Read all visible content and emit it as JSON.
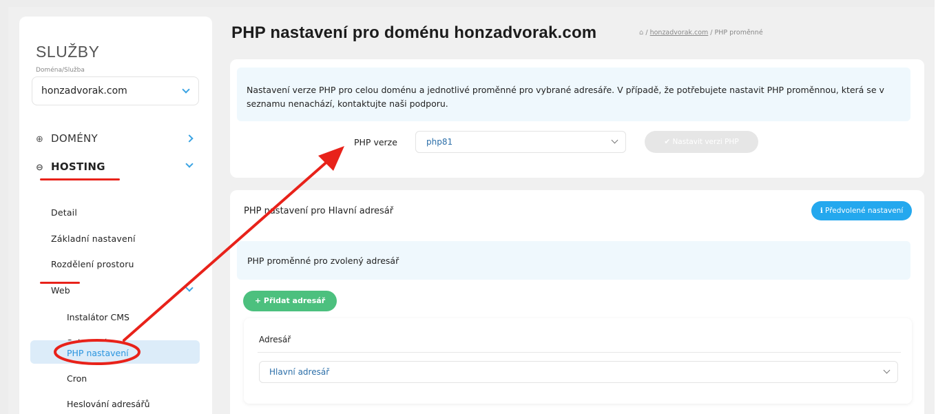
{
  "sidebar": {
    "title": "SLUŽBY",
    "domain_label": "Doména/Služba",
    "domain_value": "honzadvorak.com",
    "nav": {
      "domeny": "DOMÉNY",
      "hosting": "HOSTING"
    },
    "hosting_items": [
      "Detail",
      "Základní nastavení",
      "Rozdělení prostoru",
      "Web"
    ],
    "web_items": [
      "Instalátor CMS",
      "Subdomény",
      "PHP nastavení",
      "Cron",
      "Heslování adresářů"
    ]
  },
  "header": {
    "title": "PHP nastavení pro doménu honzadvorak.com",
    "breadcrumb": {
      "separator": "/",
      "domain": "honzadvorak.com",
      "current": "PHP proměnné"
    }
  },
  "version_card": {
    "info": "Nastavení verze PHP pro celou doménu a jednotlivé proměnné pro vybrané adresáře. V případě, že potřebujete nastavit PHP proměnnou, která se v seznamu nenachází, kontaktujte naši podporu.",
    "php_label": "PHP verze",
    "php_value": "php81",
    "set_button": "✔ Nastavit verzi PHP"
  },
  "dir_card": {
    "title": "PHP nastavení pro Hlavní adresář",
    "default_button": "ℹ Předvolené nastavení",
    "vars_heading": "PHP proměnné pro zvolený adresář",
    "add_button": "+ Přidat adresář",
    "dir_label": "Adresář",
    "dir_value": "Hlavní adresář"
  },
  "colors": {
    "accent": "#24a8ee",
    "green": "#4cc07e",
    "annotation_red": "#e8221a",
    "active_bg": "#dcecf9"
  }
}
